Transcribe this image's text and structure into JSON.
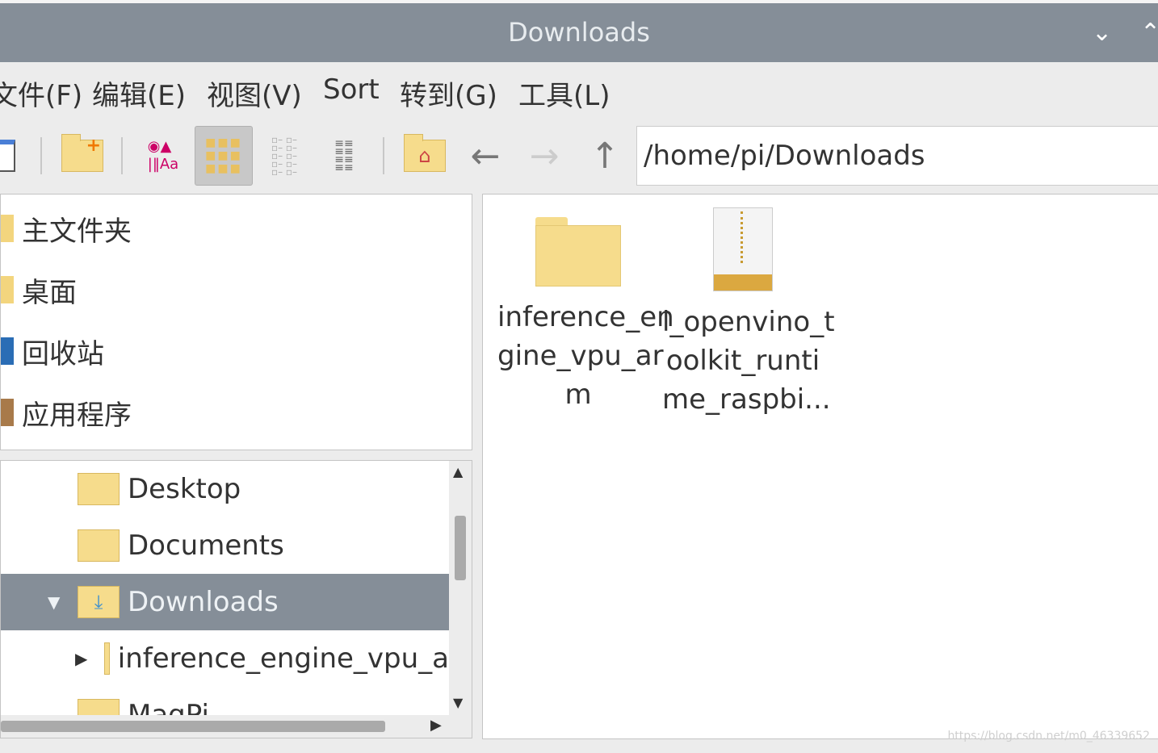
{
  "window": {
    "title": "Downloads",
    "controls": [
      "chevron-down",
      "chevron-up"
    ]
  },
  "menu": [
    "文件(F)",
    "编辑(E)",
    "视图(V)",
    "Sort",
    "转到(G)",
    "工具(L)"
  ],
  "toolbar": {
    "active_view": "icon-view",
    "address": "/home/pi/Downloads"
  },
  "places": [
    "主文件夹",
    "桌面",
    "回收站",
    "应用程序"
  ],
  "tree": [
    {
      "label": "Desktop",
      "selected": false
    },
    {
      "label": "Documents",
      "selected": false
    },
    {
      "label": "Downloads",
      "selected": true,
      "expanded": true
    },
    {
      "label": "inference_engine_vpu_a",
      "selected": false,
      "collapsed": true
    },
    {
      "label": "MagPi",
      "selected": false
    }
  ],
  "files": [
    {
      "name_lines": [
        "inference_en",
        "gine_vpu_ar",
        "m"
      ],
      "type": "folder"
    },
    {
      "name_lines": [
        "l_openvino_t",
        "oolkit_runti",
        "me_raspbi..."
      ],
      "type": "archive"
    }
  ],
  "watermark": "https://blog.csdn.net/m0_46339652",
  "colors": {
    "titlebar": "#858e98",
    "selection": "#858e98",
    "folder": "#f6dc8c"
  }
}
